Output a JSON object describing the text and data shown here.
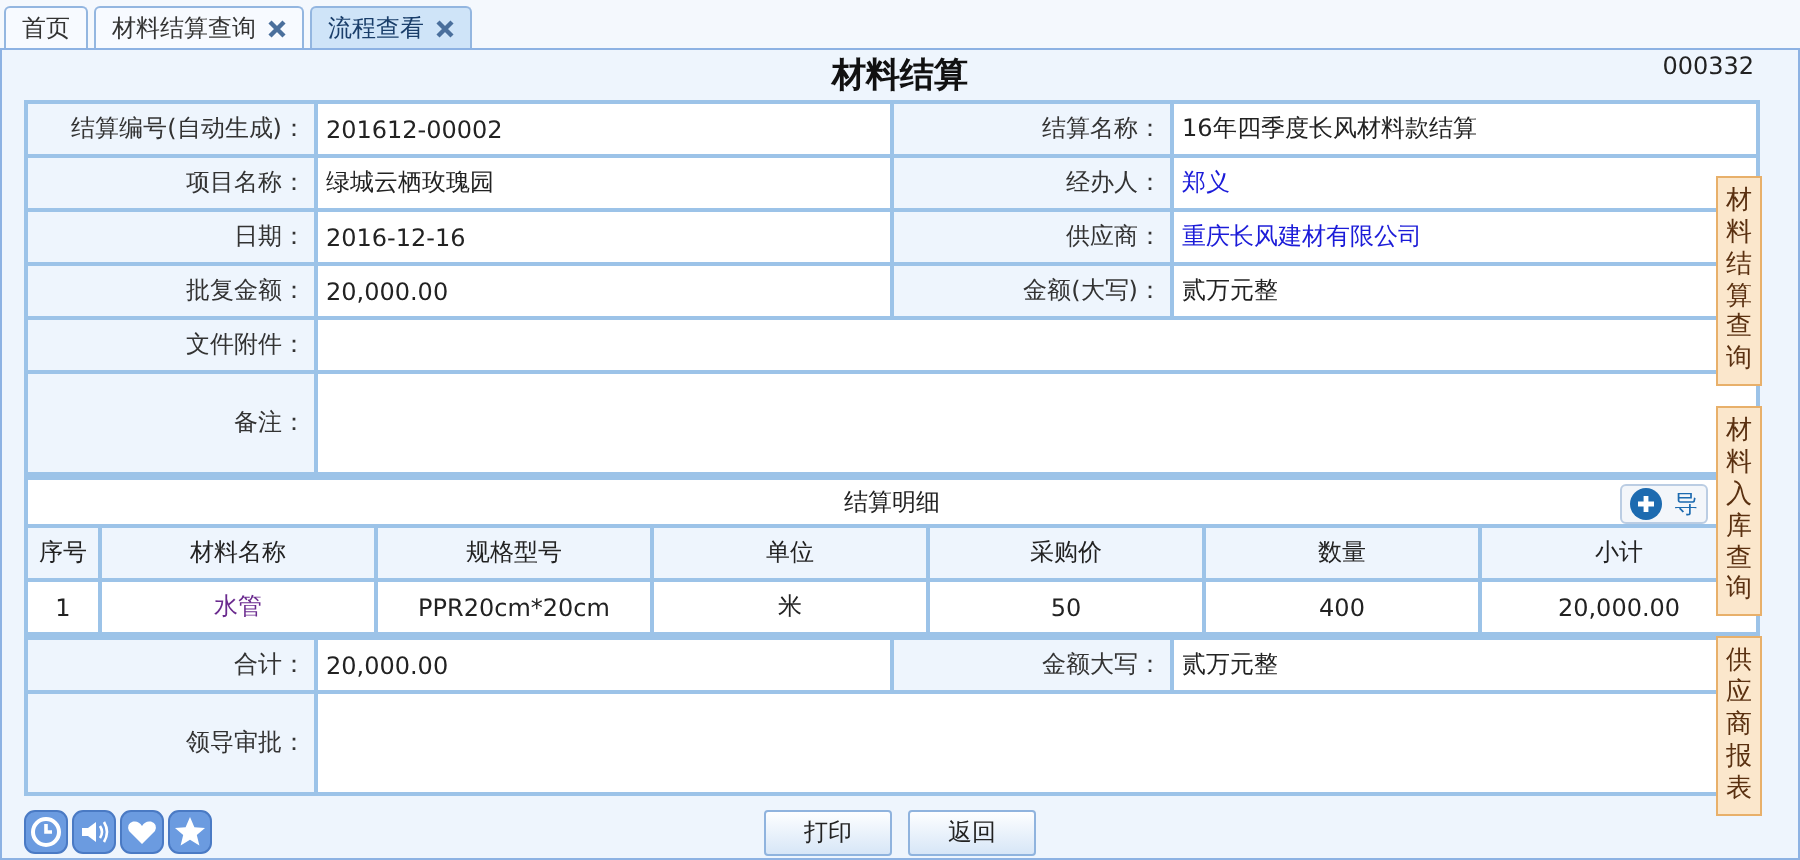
{
  "tabs": [
    {
      "label": "首页",
      "closable": false,
      "selected": false
    },
    {
      "label": "材料结算查询",
      "closable": true,
      "selected": false
    },
    {
      "label": "流程查看",
      "closable": true,
      "selected": true
    }
  ],
  "title": "材料结算",
  "code": "000332",
  "form_rows": [
    [
      {
        "label": "结算编号(自动生成)：",
        "value": "201612-00002",
        "kind": "text"
      },
      {
        "label": "结算名称：",
        "value": "16年四季度长风材料款结算",
        "kind": "text"
      }
    ],
    [
      {
        "label": "项目名称：",
        "value": "绿城云栖玫瑰园",
        "kind": "text"
      },
      {
        "label": "经办人：",
        "value": "郑义",
        "kind": "link"
      }
    ],
    [
      {
        "label": "日期：",
        "value": "2016-12-16",
        "kind": "text"
      },
      {
        "label": "供应商：",
        "value": "重庆长风建材有限公司",
        "kind": "link"
      }
    ],
    [
      {
        "label": "批复金额：",
        "value": "20,000.00",
        "kind": "text"
      },
      {
        "label": "金额(大写)：",
        "value": "贰万元整",
        "kind": "text"
      }
    ],
    [
      {
        "label": "文件附件：",
        "kind": "blank"
      }
    ],
    [
      {
        "label": "备注：",
        "kind": "tall"
      }
    ]
  ],
  "detail": {
    "title": "结算明细",
    "export_button": "导",
    "columns": [
      "序号",
      "材料名称",
      "规格型号",
      "单位",
      "采购价",
      "数量",
      "小计"
    ],
    "rows": [
      [
        {
          "text": "1",
          "kind": "text"
        },
        {
          "text": "水管",
          "kind": "visited"
        },
        {
          "text": "PPR20cm*20cm",
          "kind": "text"
        },
        {
          "text": "米",
          "kind": "text"
        },
        {
          "text": "50",
          "kind": "text"
        },
        {
          "text": "400",
          "kind": "text"
        },
        {
          "text": "20,000.00",
          "kind": "text"
        }
      ]
    ]
  },
  "summary_rows": [
    [
      {
        "label": "合计：",
        "value": "20,000.00",
        "kind": "text"
      },
      {
        "label": "金额大写：",
        "value": "贰万元整",
        "kind": "text"
      }
    ],
    [
      {
        "label": "领导审批：",
        "kind": "tall"
      }
    ]
  ],
  "side_tabs": [
    "材料结算查询",
    "材料入库查询",
    "供应商报表"
  ],
  "buttons": [
    "打印",
    "返回"
  ]
}
